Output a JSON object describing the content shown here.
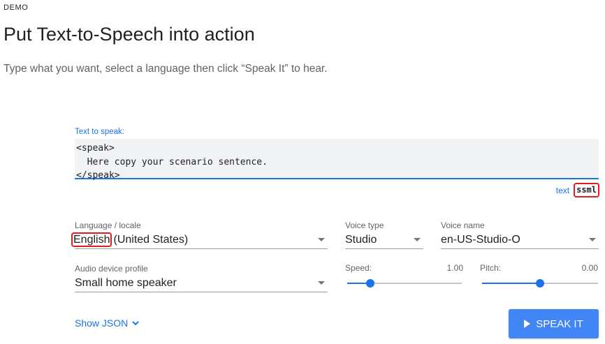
{
  "header": {
    "eyebrow": "DEMO",
    "title": "Put Text-to-Speech into action",
    "subtitle": "Type what you want, select a language then click “Speak It” to hear."
  },
  "text_input": {
    "label": "Text to speak:",
    "value": "<speak>\n  Here copy your scenario sentence.\n</speak>"
  },
  "mode": {
    "text_label": "text",
    "ssml_label": "ssml",
    "selected": "ssml"
  },
  "language": {
    "label": "Language / locale",
    "value_highlight": "English",
    "value_rest": "(United States)"
  },
  "voice_type": {
    "label": "Voice type",
    "value": "Studio"
  },
  "voice_name": {
    "label": "Voice name",
    "value": "en-US-Studio-O"
  },
  "audio_profile": {
    "label": "Audio device profile",
    "value": "Small home speaker"
  },
  "speed": {
    "label": "Speed:",
    "value": "1.00",
    "level": 0.2
  },
  "pitch": {
    "label": "Pitch:",
    "value": "0.00",
    "level": 0.5
  },
  "actions": {
    "show_json": "Show JSON",
    "speak": "SPEAK IT"
  },
  "colors": {
    "accent": "#1a73e8",
    "button": "#4285f4",
    "highlight": "#e01b24"
  }
}
